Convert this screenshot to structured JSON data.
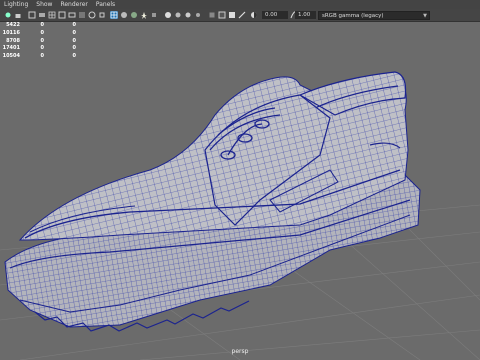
{
  "menubar": {
    "items": [
      "Lighting",
      "Show",
      "Renderer",
      "Panels"
    ]
  },
  "toolbar": {
    "exposure_value": "0.00",
    "gamma_value": "1.00",
    "color_space": "sRGB gamma (legacy)"
  },
  "hud": {
    "rows": [
      [
        "5422",
        "0",
        "0"
      ],
      [
        "10116",
        "0",
        "0"
      ],
      [
        "8708",
        "0",
        "0"
      ],
      [
        "17401",
        "0",
        "0"
      ],
      [
        "10504",
        "0",
        "0"
      ]
    ]
  },
  "viewport": {
    "camera_label": "persp"
  },
  "colors": {
    "background": "#6b6b6b",
    "wire": "#2a34a8",
    "mesh": "#bdbdc3"
  }
}
